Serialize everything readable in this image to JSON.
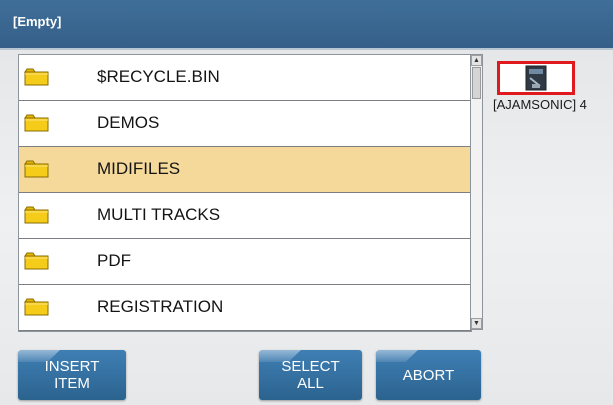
{
  "header": {
    "title": "[Empty]"
  },
  "file_list": {
    "items": [
      {
        "label": "$RECYCLE.BIN",
        "icon": "folder-icon",
        "selected": false
      },
      {
        "label": "DEMOS",
        "icon": "folder-icon",
        "selected": false
      },
      {
        "label": "MIDIFILES",
        "icon": "folder-icon",
        "selected": true
      },
      {
        "label": "MULTI TRACKS",
        "icon": "folder-icon",
        "selected": false
      },
      {
        "label": "PDF",
        "icon": "folder-icon",
        "selected": false
      },
      {
        "label": "REGISTRATION",
        "icon": "folder-icon",
        "selected": false
      }
    ]
  },
  "device": {
    "label": "[AJAMSONIC] 4",
    "icon": "usb-drive-icon"
  },
  "buttons": {
    "insert_item": "INSERT\nITEM",
    "select_all": "SELECT\nALL",
    "abort": "ABORT"
  },
  "colors": {
    "header_bg": "#3f6f99",
    "selected_row": "#f4d99a",
    "button_bg": "#3172a6",
    "device_border": "#e0191e",
    "folder": "#f5cc1a"
  }
}
